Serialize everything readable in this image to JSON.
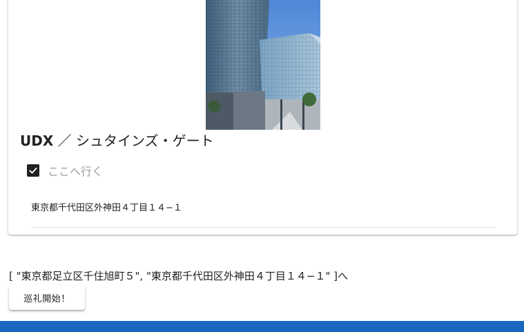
{
  "spot": {
    "title_latin": "UDX",
    "title_rest": " ／ シュタインズ・ゲート",
    "go_here_label": "ここへ行く",
    "go_here_checked": true,
    "address": "東京都千代田区外神田４丁目１４−１",
    "photo": "building-photo"
  },
  "route": {
    "text": "[ \"東京都足立区千住旭町５\", \"東京都千代田区外神田４丁目１４−１\" ]へ",
    "start_button_label": "巡礼開始！"
  },
  "icons": {
    "checkbox": "check-icon"
  },
  "colors": {
    "accent_bar": "#1a67c0",
    "checkbox": "#212121",
    "muted_text": "#9e9e9e"
  }
}
